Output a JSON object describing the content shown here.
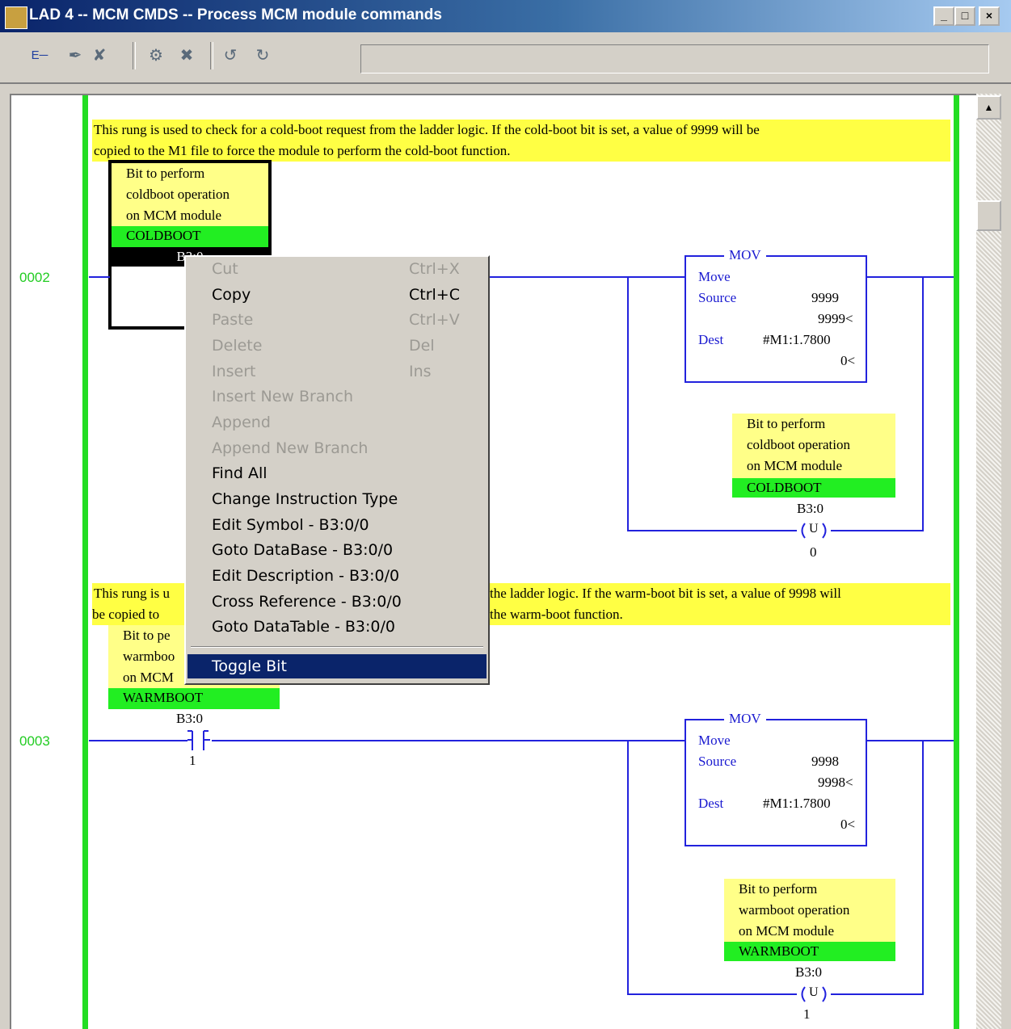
{
  "window": {
    "title": "LAD 4 -- MCM CMDS -- Process MCM module commands",
    "controls": [
      "_",
      "□",
      "×"
    ]
  },
  "toolbar": {
    "icons": [
      "contact-icon",
      "edit-icon",
      "edit-off-icon",
      "accept-icon",
      "cancel-icon",
      "test-icon",
      "untest-icon"
    ],
    "glyphs": [
      "E─",
      "✒",
      "✘",
      "⚙",
      "✖",
      "↺",
      "↻"
    ]
  },
  "scrollbar": {
    "up": "▲"
  },
  "rungs": [
    {
      "number": "0002",
      "comment": [
        "This rung is used to check for a cold-boot request from the ladder logic.  If the cold-boot bit is set, a value of 9999 will be",
        "copied to the M1 file to force the module to perform the cold-boot function."
      ],
      "contact": {
        "desc": [
          "Bit to perform",
          "coldboot operation",
          "on MCM module"
        ],
        "symbol": "COLDBOOT",
        "address": "B3:0"
      },
      "mov": {
        "title": "MOV",
        "name": "Move",
        "source_label": "Source",
        "source_value": "9999",
        "source_actual": "9999<",
        "dest_label": "Dest",
        "dest_value": "#M1:1.7800",
        "dest_actual": "0<"
      },
      "coil": {
        "desc": [
          "Bit to perform",
          "coldboot operation",
          "on MCM module"
        ],
        "symbol": "COLDBOOT",
        "address": "B3:0",
        "letter": "U",
        "bit": "0"
      }
    },
    {
      "number": "0003",
      "comment": [
        "This rung is u",
        "the ladder logic.  If the warm-boot bit is set, a value of 9998 will",
        "be copied to",
        "the warm-boot function."
      ],
      "contact": {
        "desc": [
          "Bit to pe",
          "warmboo",
          "on MCM"
        ],
        "symbol": "WARMBOOT",
        "address": "B3:0",
        "bit": "1"
      },
      "mov": {
        "title": "MOV",
        "name": "Move",
        "source_label": "Source",
        "source_value": "9998",
        "source_actual": "9998<",
        "dest_label": "Dest",
        "dest_value": "#M1:1.7800",
        "dest_actual": "0<"
      },
      "coil": {
        "desc": [
          "Bit to perform",
          "warmboot operation",
          "on MCM module"
        ],
        "symbol": "WARMBOOT",
        "address": "B3:0",
        "letter": "U",
        "bit": "1"
      }
    }
  ],
  "context_menu": {
    "items": [
      {
        "label": "Cut",
        "shortcut": "Ctrl+X",
        "enabled": false
      },
      {
        "label": "Copy",
        "shortcut": "Ctrl+C",
        "enabled": true
      },
      {
        "label": "Paste",
        "shortcut": "Ctrl+V",
        "enabled": false
      },
      {
        "label": "Delete",
        "shortcut": "Del",
        "enabled": false
      },
      {
        "label": "Insert",
        "shortcut": "Ins",
        "enabled": false
      },
      {
        "label": "Insert New Branch",
        "shortcut": "",
        "enabled": false
      },
      {
        "label": "Append",
        "shortcut": "",
        "enabled": false
      },
      {
        "label": "Append New Branch",
        "shortcut": "",
        "enabled": false
      },
      {
        "label": "Find All",
        "shortcut": "",
        "enabled": true
      },
      {
        "label": "Change Instruction Type",
        "shortcut": "",
        "enabled": true
      },
      {
        "label": "Edit Symbol - B3:0/0",
        "shortcut": "",
        "enabled": true
      },
      {
        "label": "Goto DataBase - B3:0/0",
        "shortcut": "",
        "enabled": true
      },
      {
        "label": "Edit Description - B3:0/0",
        "shortcut": "",
        "enabled": true
      },
      {
        "label": "Cross Reference - B3:0/0",
        "shortcut": "",
        "enabled": true
      },
      {
        "label": "Goto DataTable - B3:0/0",
        "shortcut": "",
        "enabled": true
      }
    ],
    "highlighted": {
      "label": "Toggle Bit"
    }
  },
  "colors": {
    "rail": "#22dd22",
    "wire": "#2222dd",
    "comment": "#ffff44",
    "symbol": "#22ee22",
    "menu_highlight": "#0a246a"
  }
}
